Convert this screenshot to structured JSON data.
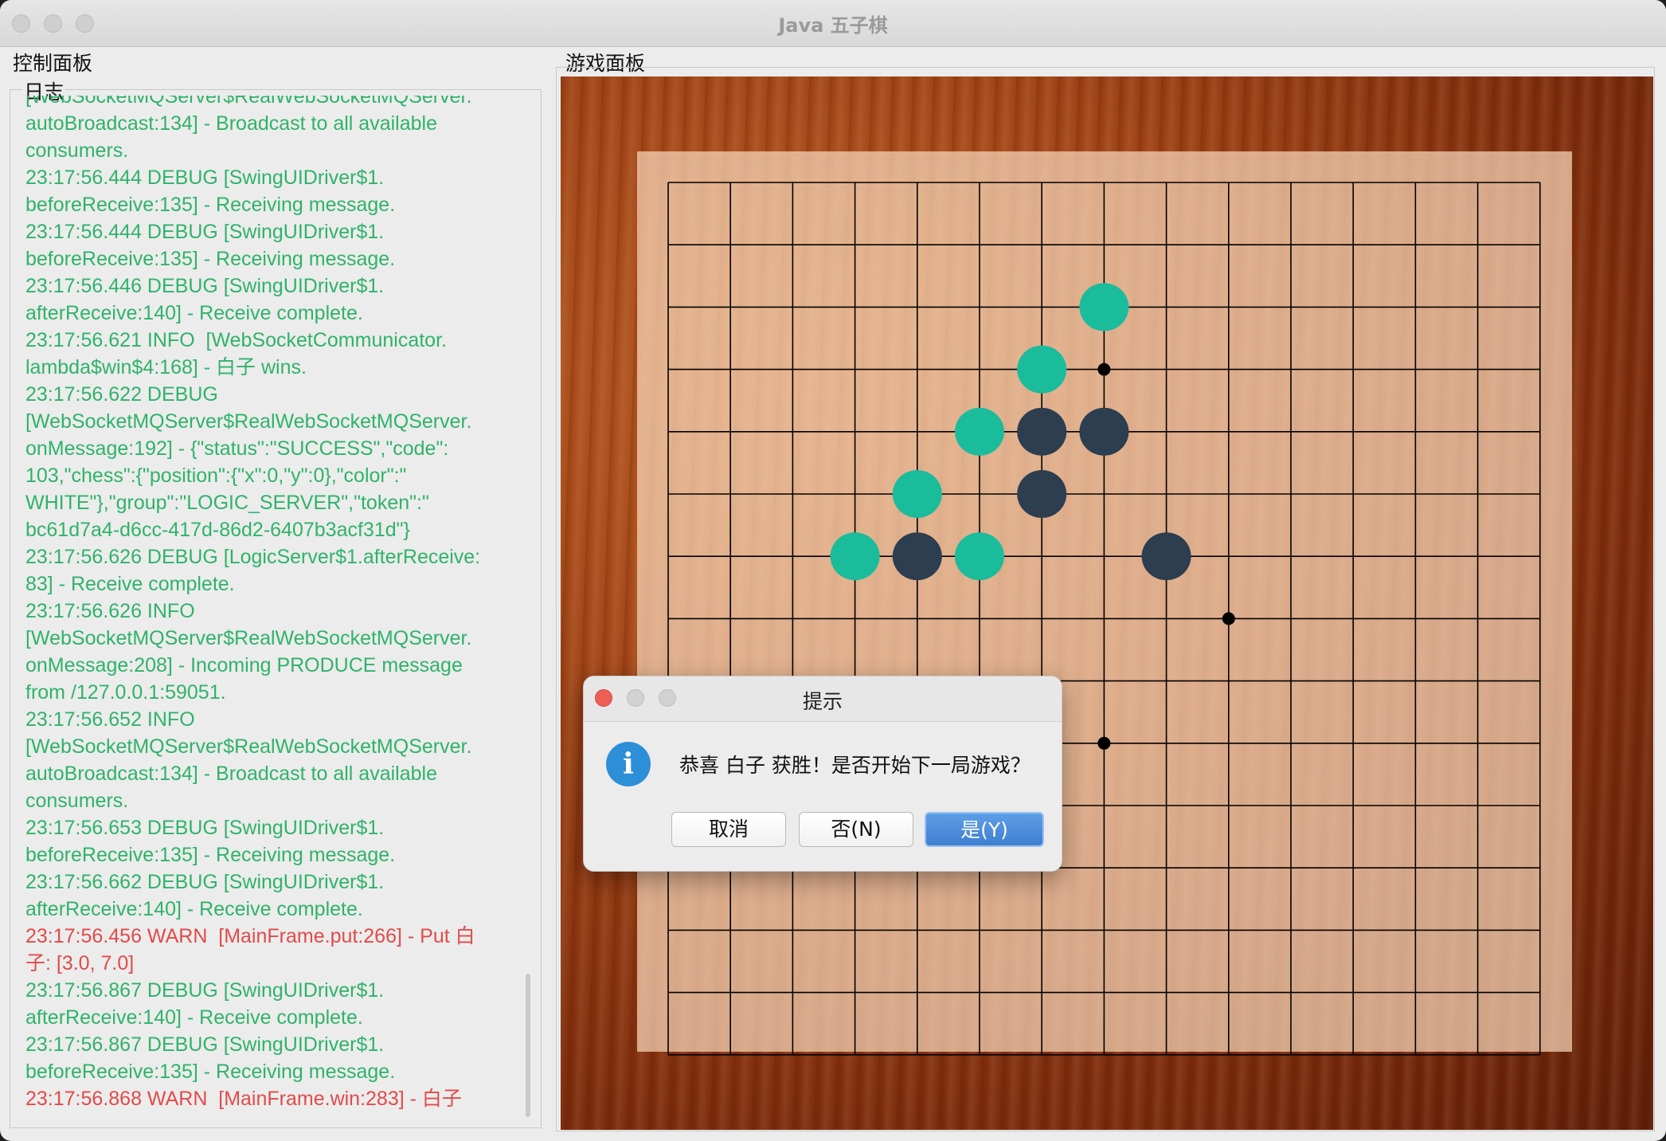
{
  "window": {
    "title": "Java 五子棋"
  },
  "left_panel": {
    "title": "控制面板",
    "log_legend": "日志",
    "log_lines": [
      {
        "text": "[WebSocketMQServer$RealWebSocketMQServer.",
        "level": "info"
      },
      {
        "text": "autoBroadcast:134] - Broadcast to all available",
        "level": "info"
      },
      {
        "text": "consumers.",
        "level": "info"
      },
      {
        "text": "23:17:56.444 DEBUG [SwingUIDriver$1.",
        "level": "info"
      },
      {
        "text": "beforeReceive:135] - Receiving message.",
        "level": "info"
      },
      {
        "text": "23:17:56.444 DEBUG [SwingUIDriver$1.",
        "level": "info"
      },
      {
        "text": "beforeReceive:135] - Receiving message.",
        "level": "info"
      },
      {
        "text": "23:17:56.446 DEBUG [SwingUIDriver$1.",
        "level": "info"
      },
      {
        "text": "afterReceive:140] - Receive complete.",
        "level": "info"
      },
      {
        "text": "23:17:56.621 INFO  [WebSocketCommunicator.",
        "level": "info"
      },
      {
        "text": "lambda$win$4:168] - 白子 wins.",
        "level": "info"
      },
      {
        "text": "23:17:56.622 DEBUG",
        "level": "info"
      },
      {
        "text": "[WebSocketMQServer$RealWebSocketMQServer.",
        "level": "info"
      },
      {
        "text": "onMessage:192] - {\"status\":\"SUCCESS\",\"code\":",
        "level": "info"
      },
      {
        "text": "103,\"chess\":{\"position\":{\"x\":0,\"y\":0},\"color\":\"",
        "level": "info"
      },
      {
        "text": "WHITE\"},\"group\":\"LOGIC_SERVER\",\"token\":\"",
        "level": "info"
      },
      {
        "text": "bc61d7a4-d6cc-417d-86d2-6407b3acf31d\"}",
        "level": "info"
      },
      {
        "text": "23:17:56.626 DEBUG [LogicServer$1.afterReceive:",
        "level": "info"
      },
      {
        "text": "83] - Receive complete.",
        "level": "info"
      },
      {
        "text": "23:17:56.626 INFO",
        "level": "info"
      },
      {
        "text": "[WebSocketMQServer$RealWebSocketMQServer.",
        "level": "info"
      },
      {
        "text": "onMessage:208] - Incoming PRODUCE message",
        "level": "info"
      },
      {
        "text": "from /127.0.0.1:59051.",
        "level": "info"
      },
      {
        "text": "23:17:56.652 INFO",
        "level": "info"
      },
      {
        "text": "[WebSocketMQServer$RealWebSocketMQServer.",
        "level": "info"
      },
      {
        "text": "autoBroadcast:134] - Broadcast to all available",
        "level": "info"
      },
      {
        "text": "consumers.",
        "level": "info"
      },
      {
        "text": "23:17:56.653 DEBUG [SwingUIDriver$1.",
        "level": "info"
      },
      {
        "text": "beforeReceive:135] - Receiving message.",
        "level": "info"
      },
      {
        "text": "23:17:56.662 DEBUG [SwingUIDriver$1.",
        "level": "info"
      },
      {
        "text": "afterReceive:140] - Receive complete.",
        "level": "info"
      },
      {
        "text": "23:17:56.456 WARN  [MainFrame.put:266] - Put 白",
        "level": "warn"
      },
      {
        "text": "子: [3.0, 7.0]",
        "level": "warn"
      },
      {
        "text": "23:17:56.867 DEBUG [SwingUIDriver$1.",
        "level": "info"
      },
      {
        "text": "afterReceive:140] - Receive complete.",
        "level": "info"
      },
      {
        "text": "23:17:56.867 DEBUG [SwingUIDriver$1.",
        "level": "info"
      },
      {
        "text": "beforeReceive:135] - Receiving message.",
        "level": "info"
      },
      {
        "text": "23:17:56.868 WARN  [MainFrame.win:283] - 白子",
        "level": "warn"
      }
    ]
  },
  "game_panel": {
    "title": "游戏面板",
    "board": {
      "lines": 15,
      "star_points": [
        [
          7,
          3
        ],
        [
          9,
          7
        ],
        [
          7,
          9
        ]
      ],
      "white_stones": [
        [
          7,
          2
        ],
        [
          6,
          3
        ],
        [
          5,
          4
        ],
        [
          4,
          5
        ],
        [
          3,
          6
        ],
        [
          5,
          6
        ]
      ],
      "black_stones": [
        [
          6,
          4
        ],
        [
          7,
          4
        ],
        [
          6,
          5
        ],
        [
          4,
          6
        ],
        [
          8,
          6
        ]
      ],
      "colors": {
        "white_stone": "#1abc9c",
        "black_stone": "#2c3e50",
        "line": "#000000"
      }
    }
  },
  "dialog": {
    "title": "提示",
    "icon": "info-icon",
    "message": "恭喜 白子 获胜！是否开始下一局游戏？",
    "buttons": {
      "cancel": "取消",
      "no": "否(N)",
      "yes": "是(Y)"
    }
  }
}
